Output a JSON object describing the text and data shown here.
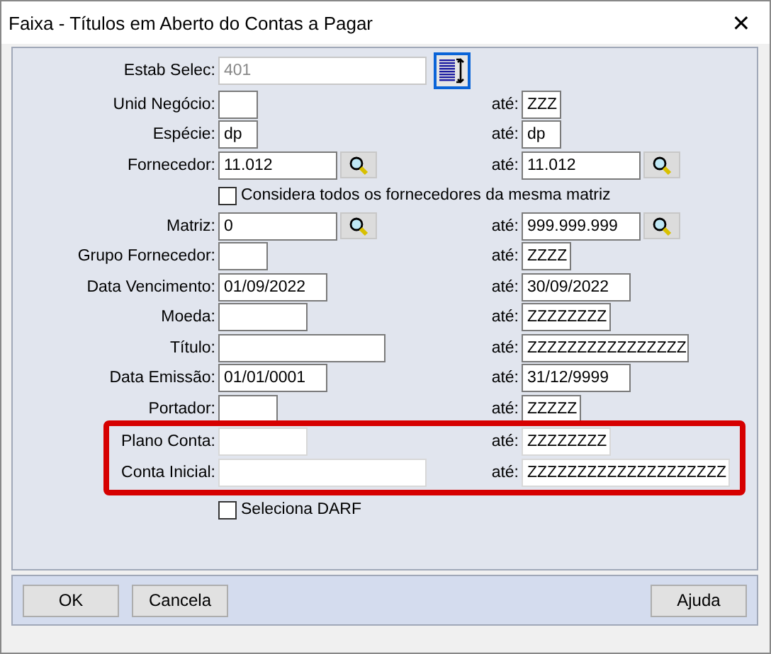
{
  "window": {
    "title": "Faixa - Títulos em Aberto do Contas a Pagar",
    "close": "✕"
  },
  "rows": [
    {
      "kind": "field",
      "label": "Estab Selec:",
      "value": "401",
      "disabled": true,
      "picker": true
    },
    {
      "kind": "field",
      "label": "Unid Negócio:",
      "value": "",
      "to_label": "até:",
      "to_value": "ZZZ"
    },
    {
      "kind": "field",
      "label": "Espécie:",
      "value": "dp",
      "to_label": "até:",
      "to_value": "dp"
    },
    {
      "kind": "field",
      "label": "Fornecedor:",
      "value": "11.012",
      "lookup": true,
      "to_label": "até:",
      "to_value": "11.012",
      "to_lookup": true
    },
    {
      "kind": "checkbox",
      "label": "Considera todos os fornecedores da mesma matriz",
      "checked": false
    },
    {
      "kind": "field",
      "label": "Matriz:",
      "value": "0",
      "lookup": true,
      "to_label": "até:",
      "to_value": "999.999.999",
      "to_lookup": true
    },
    {
      "kind": "field",
      "label": "Grupo Fornecedor:",
      "value": "",
      "to_label": "até:",
      "to_value": "ZZZZ"
    },
    {
      "kind": "field",
      "label": "Data Vencimento:",
      "value": "01/09/2022",
      "to_label": "até:",
      "to_value": "30/09/2022"
    },
    {
      "kind": "field",
      "label": "Moeda:",
      "value": "",
      "to_label": "até:",
      "to_value": "ZZZZZZZZ"
    },
    {
      "kind": "field",
      "label": "Título:",
      "value": "",
      "to_label": "até:",
      "to_value": "ZZZZZZZZZZZZZZZZ"
    },
    {
      "kind": "field",
      "label": "Data Emissão:",
      "value": "01/01/0001",
      "to_label": "até:",
      "to_value": "31/12/9999"
    },
    {
      "kind": "field",
      "label": "Portador:",
      "value": "",
      "to_label": "até:",
      "to_value": "ZZZZZ"
    },
    {
      "kind": "field",
      "label": "Plano Conta:",
      "value": "",
      "highlighted": true,
      "to_label": "até:",
      "to_value": "ZZZZZZZZ"
    },
    {
      "kind": "field",
      "label": "Conta Inicial:",
      "value": "",
      "highlighted": true,
      "to_label": "até:",
      "to_value": "ZZZZZZZZZZZZZZZZZZZZ"
    },
    {
      "kind": "checkbox",
      "label": "Seleciona DARF",
      "checked": false
    }
  ],
  "buttons": [
    {
      "label": "OK"
    },
    {
      "label": "Cancela"
    },
    {
      "label": "Ajuda"
    }
  ]
}
